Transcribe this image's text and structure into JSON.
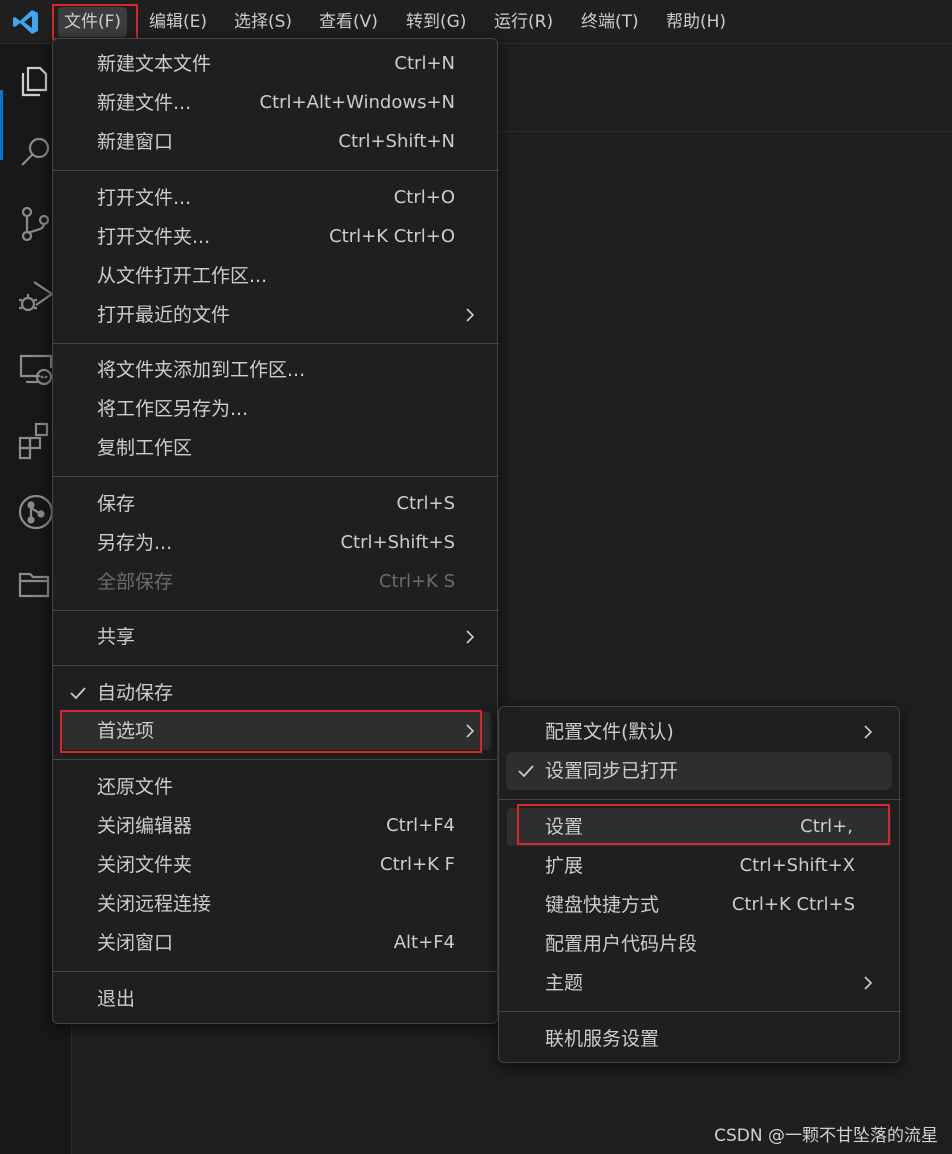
{
  "menubar": {
    "items": [
      "文件(F)",
      "编辑(E)",
      "选择(S)",
      "查看(V)",
      "转到(G)",
      "运行(R)",
      "终端(T)",
      "帮助(H)"
    ]
  },
  "file_menu": {
    "items": [
      {
        "label": "新建文本文件",
        "key": "Ctrl+N"
      },
      {
        "label": "新建文件...",
        "key": "Ctrl+Alt+Windows+N"
      },
      {
        "label": "新建窗口",
        "key": "Ctrl+Shift+N"
      },
      {
        "label": "打开文件...",
        "key": "Ctrl+O"
      },
      {
        "label": "打开文件夹...",
        "key": "Ctrl+K Ctrl+O"
      },
      {
        "label": "从文件打开工作区..."
      },
      {
        "label": "打开最近的文件",
        "submenu": true
      },
      {
        "label": "将文件夹添加到工作区..."
      },
      {
        "label": "将工作区另存为..."
      },
      {
        "label": "复制工作区"
      },
      {
        "label": "保存",
        "key": "Ctrl+S"
      },
      {
        "label": "另存为...",
        "key": "Ctrl+Shift+S"
      },
      {
        "label": "全部保存",
        "key": "Ctrl+K S",
        "disabled": true
      },
      {
        "label": "共享",
        "submenu": true
      },
      {
        "label": "自动保存",
        "checked": true
      },
      {
        "label": "首选项",
        "submenu": true,
        "highlighted": true
      },
      {
        "label": "还原文件"
      },
      {
        "label": "关闭编辑器",
        "key": "Ctrl+F4"
      },
      {
        "label": "关闭文件夹",
        "key": "Ctrl+K F"
      },
      {
        "label": "关闭远程连接"
      },
      {
        "label": "关闭窗口",
        "key": "Alt+F4"
      },
      {
        "label": "退出"
      }
    ]
  },
  "preferences_menu": {
    "items": [
      {
        "label": "配置文件(默认)",
        "submenu": true
      },
      {
        "label": "设置同步已打开",
        "checked": true
      },
      {
        "label": "设置",
        "key": "Ctrl+,",
        "highlighted": true
      },
      {
        "label": "扩展",
        "key": "Ctrl+Shift+X"
      },
      {
        "label": "键盘快捷方式",
        "key": "Ctrl+K Ctrl+S"
      },
      {
        "label": "配置用户代码片段"
      },
      {
        "label": "主题",
        "submenu": true
      },
      {
        "label": "联机服务设置"
      }
    ]
  },
  "watermark": "CSDN @一颗不甘坠落的流星",
  "colors": {
    "accent": "#0078d4",
    "annotation_red": "#d9262b",
    "logo": "#3ea5f2"
  }
}
